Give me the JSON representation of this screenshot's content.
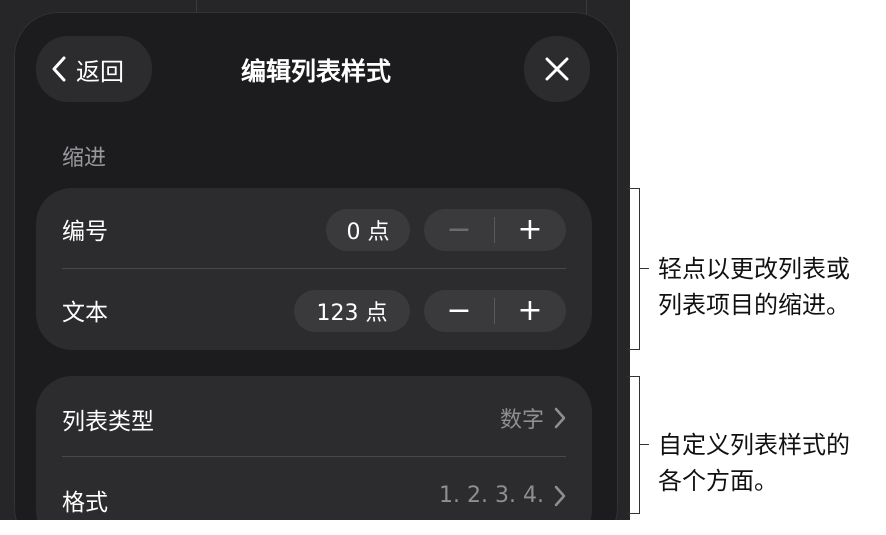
{
  "header": {
    "back_label": "返回",
    "title": "编辑列表样式"
  },
  "indent": {
    "section_label": "缩进",
    "rows": [
      {
        "label": "编号",
        "value": "0 点",
        "minus": "−",
        "plus": "+"
      },
      {
        "label": "文本",
        "value": "123 点",
        "minus": "−",
        "plus": "+"
      }
    ]
  },
  "list_style": {
    "rows": [
      {
        "label": "列表类型",
        "value": "数字"
      },
      {
        "label": "格式",
        "value": "1. 2. 3. 4."
      }
    ]
  },
  "callouts": {
    "first": [
      "轻点以更改列表或",
      "列表项目的缩进。"
    ],
    "second": [
      "自定义列表样式的",
      "各个方面。"
    ]
  },
  "icons": {
    "back": "chevron-left-icon",
    "close": "close-icon",
    "disclosure": "chevron-right-icon"
  },
  "colors": {
    "background": "#262628",
    "sheet": "#1c1c1e",
    "group": "#2c2c2e",
    "control": "#3a3a3c",
    "secondary_text": "#8e8e93"
  }
}
